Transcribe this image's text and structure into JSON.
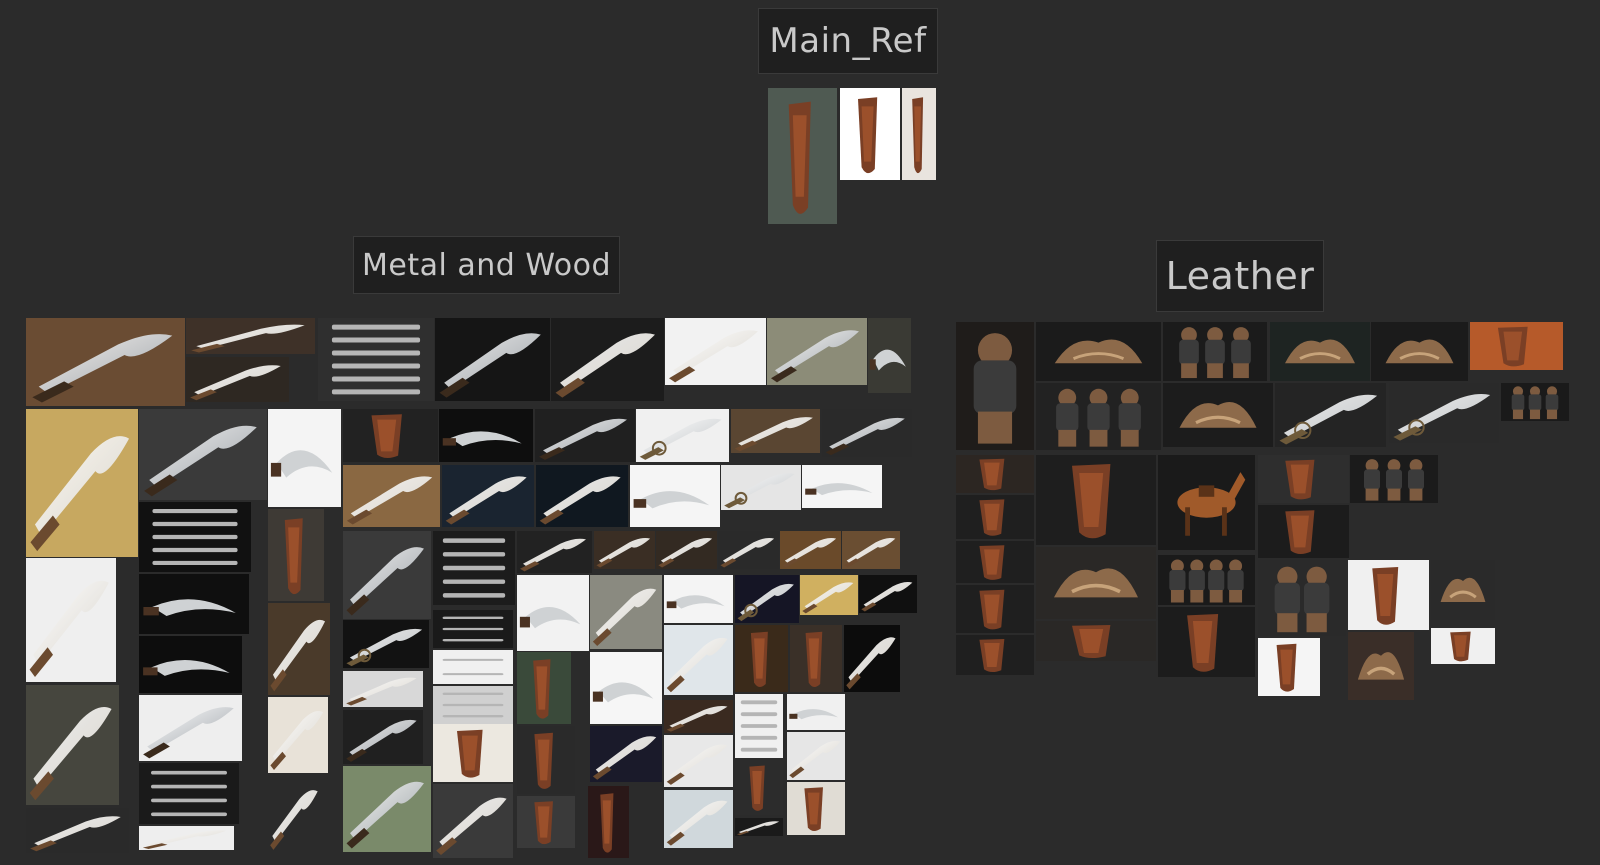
{
  "canvas": {
    "background": "#2b2b2b",
    "groups": [
      {
        "id": "main",
        "title": "Main_Ref"
      },
      {
        "id": "metal",
        "title": "Metal and Wood"
      },
      {
        "id": "leather",
        "title": "Leather"
      }
    ]
  },
  "palette": {
    "label_bg": "#1f1f1f",
    "label_text": "#c9c9c9",
    "leather": "#7a3f25",
    "wood": "#6b4a2f",
    "steel": "#b8b8b8"
  }
}
